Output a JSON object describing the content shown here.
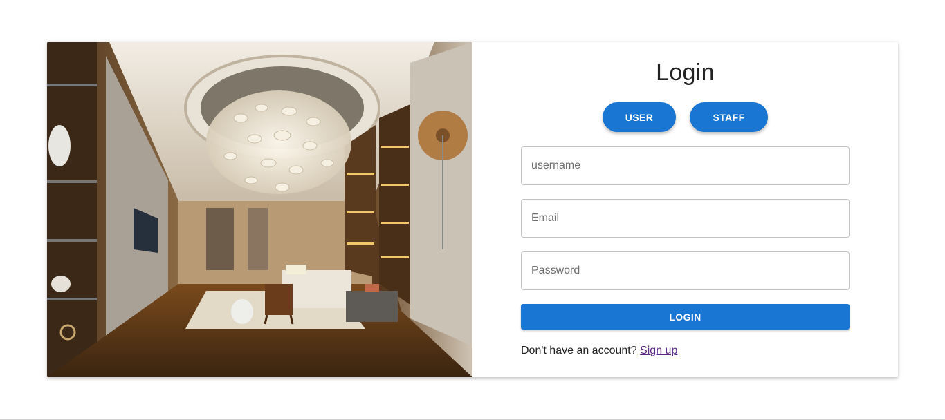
{
  "login": {
    "title": "Login",
    "roles": {
      "user_label": "USER",
      "staff_label": "STAFF"
    },
    "fields": {
      "username_placeholder": "username",
      "email_placeholder": "Email",
      "password_placeholder": "Password"
    },
    "submit_label": "LOGIN",
    "signup_prompt": "Don't have an account?",
    "signup_link": "Sign up"
  },
  "colors": {
    "primary": "#1976d2",
    "link": "#5b2a86"
  },
  "image": {
    "subject": "luxury interior living room with shell chandelier"
  }
}
